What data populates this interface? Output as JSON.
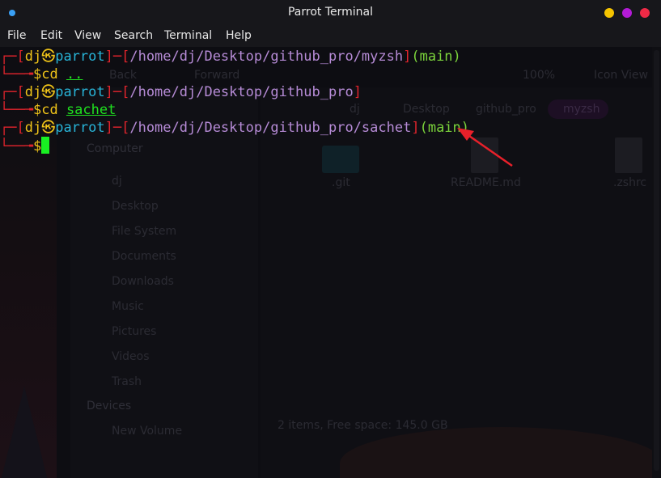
{
  "window": {
    "title": "Parrot Terminal",
    "colors": {
      "app_dot": "#3aa0f5",
      "minimize": "#f5c400",
      "maximize": "#b31bd6",
      "close": "#ee2a46"
    }
  },
  "menu": [
    "File",
    "Edit",
    "View",
    "Search",
    "Terminal",
    "Help"
  ],
  "terminal": {
    "prompts": [
      {
        "user": "dj",
        "host": "parrot",
        "path": "/home/dj/Desktop/github_pro/myzsh",
        "branch": "(main)",
        "command": "cd",
        "argument": ".."
      },
      {
        "user": "dj",
        "host": "parrot",
        "path": "/home/dj/Desktop/github_pro",
        "branch": "",
        "command": "cd",
        "argument": "sachet"
      },
      {
        "user": "dj",
        "host": "parrot",
        "path": "/home/dj/Desktop/github_pro/sachet",
        "branch": "(main)",
        "command": "",
        "argument": ""
      }
    ],
    "skull_symbol": "㉿",
    "prompt_symbol": "$",
    "colors": {
      "bracket": "#e0242c",
      "user": "#f0c419",
      "host": "#28b4d8",
      "path": "#b68bd6",
      "branch": "#7bd33b",
      "cursor": "#19f022"
    }
  },
  "background_filemanager": {
    "toolbar": {
      "back": "Back",
      "forward": "Forward",
      "zoom": "100%",
      "view_mode": "Icon View"
    },
    "breadcrumbs": [
      "dj",
      "Desktop",
      "github_pro",
      "myzsh"
    ],
    "sidebar_sections": [
      {
        "heading": "Computer",
        "items": [
          "dj",
          "Desktop",
          "File System",
          "Documents",
          "Downloads",
          "Music",
          "Pictures",
          "Videos",
          "Trash"
        ]
      },
      {
        "heading": "Devices",
        "items": [
          "New Volume"
        ]
      }
    ],
    "files": [
      ".git",
      "README.md",
      ".zshrc"
    ],
    "status": "2 items, Free space: 145.0 GB"
  },
  "annotation": {
    "arrow_color": "#e8202a"
  }
}
